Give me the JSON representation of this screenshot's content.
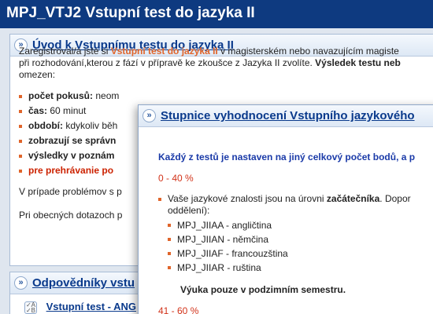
{
  "header": {
    "title": "MPJ_VTJ2 Vstupní test do jazyka II"
  },
  "intro": {
    "title": "Úvod k Vstupnímu testu do jazyka II",
    "p1_pre": "Zaregistroval/a jste si ",
    "p1_highlight": "Vstupní test do jazyka II",
    "p1_post": " v magisterském nebo navazujícím magiste",
    "p2_pre": "při rozhodování,kterou z fází v přípravě ke zkoušce z Jazyka II zvolíte. ",
    "p2_bold": "Výsledek testu neb",
    "p3": "omezen:",
    "items": [
      {
        "label": "počet pokusů:",
        "value": " neom"
      },
      {
        "label": "čas:",
        "value": " 60 minut"
      },
      {
        "label": "období:",
        "value": " kdykoliv běh"
      },
      {
        "label": "zobrazují se správn",
        "value": ""
      },
      {
        "label": "výsledky v poznám",
        "value": ""
      }
    ],
    "red_item": "pre prehrávanie po",
    "problems": "V prípade problémov s p",
    "general": "Pri obecných dotazoch p"
  },
  "answers": {
    "title": "Odpovědníky vstu",
    "item_label": "Vstupní test - ANG"
  },
  "scale": {
    "title": "Stupnice vyhodnocení Vstupního jazykového",
    "intro": "Každý z testů je nastaven na jiný celkový počet bodů, a p",
    "range1": "0 - 40 %",
    "level_pre": "Vaše jazykové znalosti jsou na úrovni ",
    "level_bold": "začátečníka",
    "level_post": ". Dopor",
    "level_cont": "oddělení):",
    "subjects": [
      "MPJ_JIIAA - angličtina",
      "MPJ_JIIAN - němčina",
      "MPJ_JIIAF - francouzština",
      "MPJ_JIIAR - ruština"
    ],
    "note": "Výuka pouze v podzimním semestru.",
    "range2": "41 - 60 %"
  }
}
